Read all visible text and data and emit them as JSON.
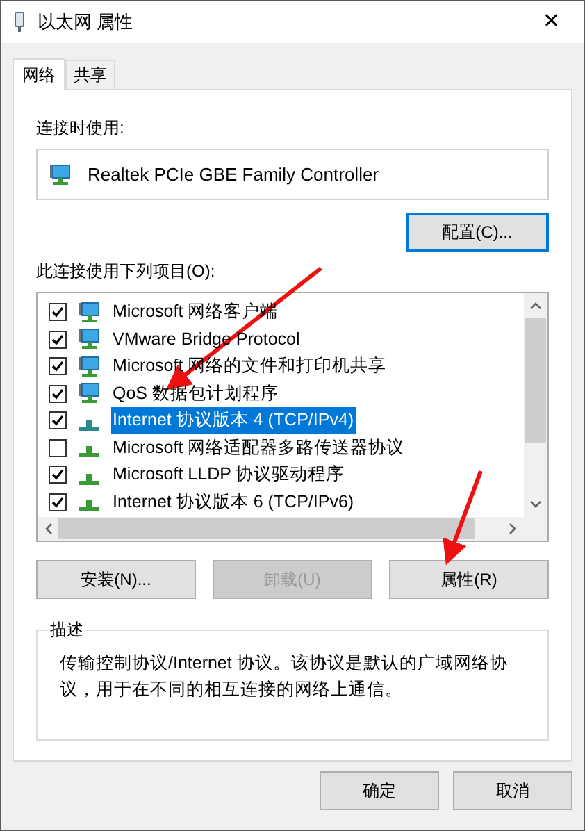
{
  "window": {
    "title": "以太网 属性",
    "close": "✕"
  },
  "tabs": [
    {
      "label": "网络",
      "selected": true
    },
    {
      "label": "共享",
      "selected": false
    }
  ],
  "connect_using": {
    "label": "连接时使用:",
    "adapter": "Realtek PCIe GBE Family Controller",
    "configure_button": "配置(C)..."
  },
  "items_label": "此连接使用下列项目(O):",
  "items": [
    {
      "label": "Microsoft 网络客户端",
      "checked": true,
      "selected": false,
      "kind": "monitor"
    },
    {
      "label": "VMware Bridge Protocol",
      "checked": true,
      "selected": false,
      "kind": "monitor"
    },
    {
      "label": "Microsoft 网络的文件和打印机共享",
      "checked": true,
      "selected": false,
      "kind": "monitor"
    },
    {
      "label": "QoS 数据包计划程序",
      "checked": true,
      "selected": false,
      "kind": "monitor"
    },
    {
      "label": "Internet 协议版本 4 (TCP/IPv4)",
      "checked": true,
      "selected": true,
      "kind": "connector"
    },
    {
      "label": "Microsoft 网络适配器多路传送器协议",
      "checked": false,
      "selected": false,
      "kind": "connector"
    },
    {
      "label": "Microsoft LLDP 协议驱动程序",
      "checked": true,
      "selected": false,
      "kind": "connector"
    },
    {
      "label": "Internet 协议版本 6 (TCP/IPv6)",
      "checked": true,
      "selected": false,
      "kind": "connector"
    }
  ],
  "item_buttons": [
    {
      "label": "安装(N)...",
      "disabled": false
    },
    {
      "label": "卸载(U)",
      "disabled": true
    },
    {
      "label": "属性(R)",
      "disabled": false
    }
  ],
  "description": {
    "title": "描述",
    "text": "传输控制协议/Internet 协议。该协议是默认的广域网络协议，用于在不同的相互连接的网络上通信。"
  },
  "dialog_buttons": [
    "确定",
    "取消"
  ]
}
